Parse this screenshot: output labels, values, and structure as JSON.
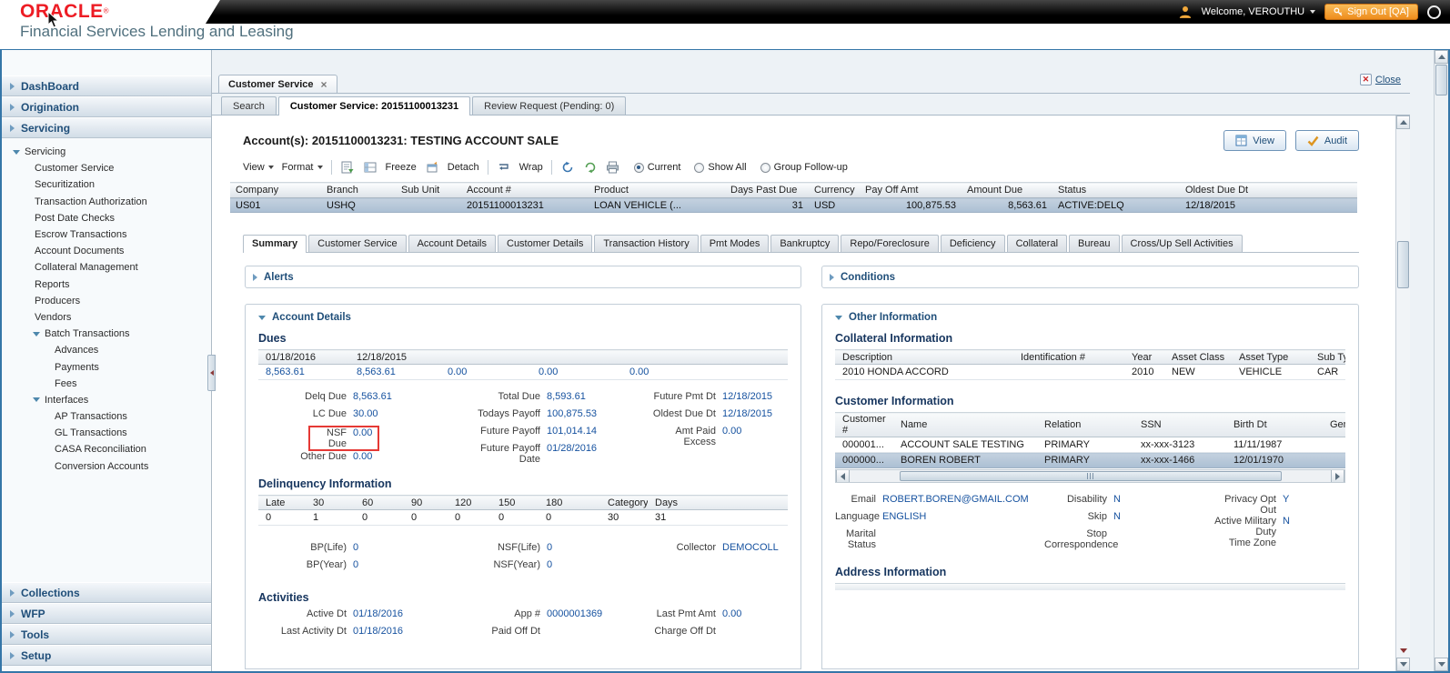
{
  "colors": {
    "oracle_red": "#ed1c24",
    "signout_orange": "#ee8c1c",
    "link_blue": "#15519f",
    "heading_navy": "#16355e",
    "selected_row": "#b3c5d8",
    "nsf_highlight_border": "#e53935"
  },
  "header": {
    "brand": "ORACLE",
    "trademark": "®",
    "subtitle": "Financial Services Lending and Leasing",
    "welcome": "Welcome, VEROUTHU",
    "sign_out": "Sign Out [QA]"
  },
  "sidebar": {
    "groups": [
      {
        "label": "DashBoard"
      },
      {
        "label": "Origination"
      },
      {
        "label": "Servicing"
      },
      {
        "label": "Collections"
      },
      {
        "label": "WFP"
      },
      {
        "label": "Tools"
      },
      {
        "label": "Setup"
      }
    ],
    "tree": {
      "root": "Servicing",
      "items": [
        "Customer Service",
        "Securitization",
        "Transaction Authorization",
        "Post Date Checks",
        "Escrow Transactions",
        "Account Documents",
        "Collateral Management",
        "Reports",
        "Producers",
        "Vendors"
      ],
      "batch_transactions": {
        "label": "Batch Transactions",
        "items": [
          "Advances",
          "Payments",
          "Fees"
        ]
      },
      "interfaces": {
        "label": "Interfaces",
        "items": [
          "AP Transactions",
          "GL Transactions",
          "CASA Reconciliation",
          "Conversion Accounts"
        ]
      }
    }
  },
  "window_tab": {
    "label": "Customer Service",
    "close": "×"
  },
  "close_button": {
    "label": "Close"
  },
  "subtabs": [
    "Search",
    "Customer Service: 20151100013231",
    "Review Request (Pending: 0)"
  ],
  "account_section": {
    "title": "Account(s): 20151100013231: TESTING ACCOUNT SALE",
    "view_button": "View",
    "audit_button": "Audit"
  },
  "toolbar": {
    "view": "View",
    "format": "Format",
    "freeze": "Freeze",
    "detach": "Detach",
    "wrap": "Wrap",
    "radios": [
      "Current",
      "Show All",
      "Group Follow-up"
    ],
    "selected_radio": "Current"
  },
  "accounts_table": {
    "columns": [
      "Company",
      "Branch",
      "Sub Unit",
      "Account #",
      "Product",
      "Days Past Due",
      "Currency",
      "Pay Off Amt",
      "Amount Due",
      "Status",
      "Oldest Due Dt"
    ],
    "row": [
      "US01",
      "USHQ",
      "",
      "20151100013231",
      "LOAN VEHICLE (...",
      "31",
      "USD",
      "100,875.53",
      "8,563.61",
      "ACTIVE:DELQ",
      "12/18/2015"
    ]
  },
  "detail_tabs": [
    "Summary",
    "Customer Service",
    "Account Details",
    "Customer Details",
    "Transaction History",
    "Pmt Modes",
    "Bankruptcy",
    "Repo/Foreclosure",
    "Deficiency",
    "Collateral",
    "Bureau",
    "Cross/Up Sell Activities"
  ],
  "active_detail_tab": "Summary",
  "alerts": {
    "title": "Alerts"
  },
  "conditions": {
    "title": "Conditions"
  },
  "account_details": {
    "title": "Account Details",
    "dues": {
      "heading": "Dues",
      "columns": [
        "01/18/2016",
        "12/18/2015",
        "",
        "",
        ""
      ],
      "values": [
        "8,563.61",
        "8,563.61",
        "0.00",
        "0.00",
        "0.00"
      ],
      "fields": [
        {
          "label": "Delq Due",
          "value": "8,563.61"
        },
        {
          "label": "LC Due",
          "value": "30.00"
        },
        {
          "label": "NSF Due",
          "value": "0.00"
        },
        {
          "label": "Other Due",
          "value": "0.00"
        },
        {
          "label": "Total Due",
          "value": "8,593.61"
        },
        {
          "label": "Todays Payoff",
          "value": "100,875.53"
        },
        {
          "label": "Future Payoff",
          "value": "101,014.14"
        },
        {
          "label": "Future Payoff Date",
          "value": "01/28/2016"
        },
        {
          "label": "Future Pmt Dt",
          "value": "12/18/2015"
        },
        {
          "label": "Oldest Due Dt",
          "value": "12/18/2015"
        },
        {
          "label": "Amt Paid Excess",
          "value": "0.00"
        }
      ]
    },
    "delinquency": {
      "heading": "Delinquency Information",
      "columns": [
        "Late",
        "30",
        "60",
        "90",
        "120",
        "150",
        "180",
        "Category",
        "Days"
      ],
      "values": [
        "0",
        "1",
        "0",
        "0",
        "0",
        "0",
        "0",
        "30",
        "31"
      ],
      "fields": [
        {
          "label": "BP(Life)",
          "value": "0"
        },
        {
          "label": "BP(Year)",
          "value": "0"
        },
        {
          "label": "NSF(Life)",
          "value": "0"
        },
        {
          "label": "NSF(Year)",
          "value": "0"
        },
        {
          "label": "Collector",
          "value": "DEMOCOLL"
        }
      ]
    },
    "activities": {
      "heading": "Activities",
      "fields": [
        {
          "label": "Active Dt",
          "value": "01/18/2016"
        },
        {
          "label": "Last Activity Dt",
          "value": "01/18/2016"
        },
        {
          "label": "App #",
          "value": "0000001369"
        },
        {
          "label": "Paid Off Dt",
          "value": ""
        },
        {
          "label": "Last Pmt Amt",
          "value": "0.00"
        },
        {
          "label": "Charge Off Dt",
          "value": ""
        }
      ]
    }
  },
  "other_information": {
    "title": "Other Information",
    "collateral": {
      "heading": "Collateral Information",
      "columns": [
        "Description",
        "Identification #",
        "Year",
        "Asset Class",
        "Asset Type",
        "Sub Type"
      ],
      "row": [
        "2010 HONDA ACCORD",
        "",
        "2010",
        "NEW",
        "VEHICLE",
        "CAR"
      ]
    },
    "customer": {
      "heading": "Customer Information",
      "columns": [
        "Customer #",
        "Name",
        "Relation",
        "SSN",
        "Birth Dt",
        "Gender"
      ],
      "rows": [
        [
          "000001...",
          "ACCOUNT SALE TESTING",
          "PRIMARY",
          "xx-xxx-3123",
          "11/11/1987",
          ""
        ],
        [
          "000000...",
          "BOREN ROBERT",
          "PRIMARY",
          "xx-xxx-1466",
          "12/01/1970",
          ""
        ]
      ]
    },
    "fields": [
      {
        "label": "Email",
        "value": "ROBERT.BOREN@GMAIL.COM"
      },
      {
        "label": "Language",
        "value": "ENGLISH"
      },
      {
        "label": "Marital Status",
        "value": ""
      },
      {
        "label": "Disability",
        "value": "N"
      },
      {
        "label": "Skip",
        "value": "N"
      },
      {
        "label": "Stop Correspondence",
        "value": ""
      },
      {
        "label": "Privacy Opt Out",
        "value": "Y"
      },
      {
        "label": "Active Military Duty",
        "value": "N"
      },
      {
        "label": "Time Zone",
        "value": ""
      }
    ],
    "address": {
      "heading": "Address Information"
    }
  }
}
